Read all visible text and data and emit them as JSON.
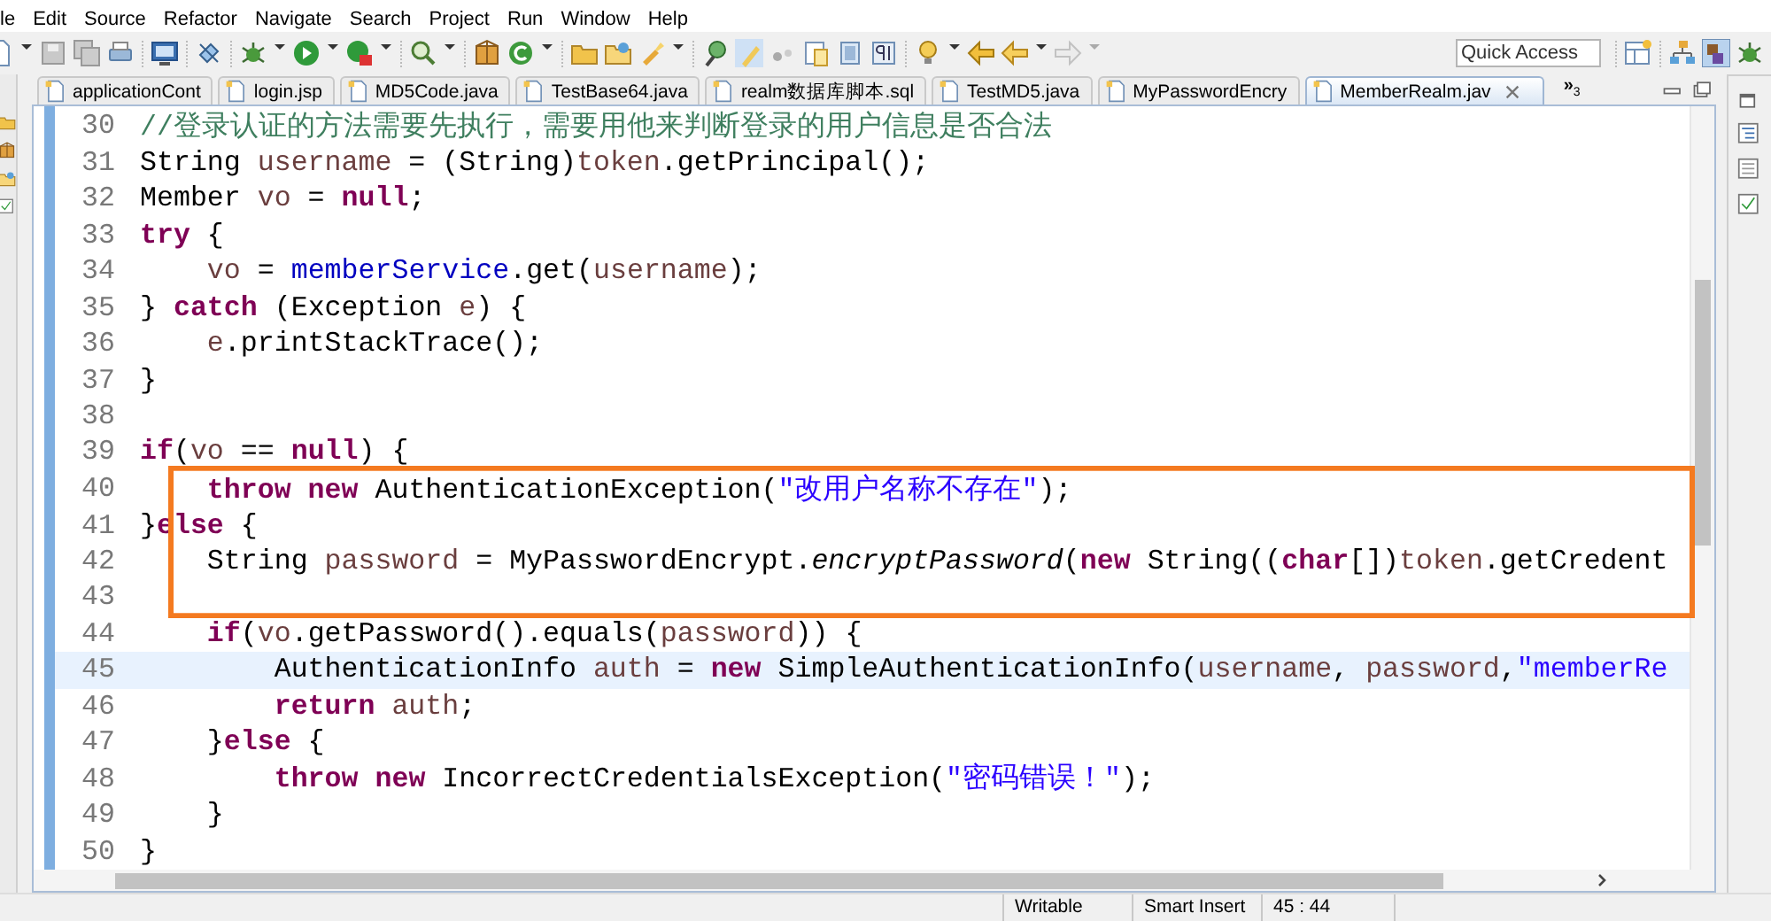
{
  "menu": [
    {
      "label": "le"
    },
    {
      "label": "Edit"
    },
    {
      "label": "Source"
    },
    {
      "label": "Refactor"
    },
    {
      "label": "Navigate"
    },
    {
      "label": "Search"
    },
    {
      "label": "Project"
    },
    {
      "label": "Run"
    },
    {
      "label": "Window"
    },
    {
      "label": "Help"
    }
  ],
  "quick_access": {
    "placeholder": "Quick Access"
  },
  "tabs": [
    {
      "label": "applicationCont",
      "selected": false
    },
    {
      "label": "login.jsp",
      "selected": false
    },
    {
      "label": "MD5Code.java",
      "selected": false
    },
    {
      "label": "TestBase64.java",
      "selected": false
    },
    {
      "label": "realm数据库脚本.sql",
      "selected": false
    },
    {
      "label": "TestMD5.java",
      "selected": false
    },
    {
      "label": "MyPasswordEncry",
      "selected": false
    },
    {
      "label": "MemberRealm.jav",
      "selected": true
    }
  ],
  "tab_overflow": {
    "glyph": "»",
    "count": "3"
  },
  "editor": {
    "lines": [
      {
        "number": "30",
        "current": false,
        "tokens": [
          {
            "kind": "comment",
            "text": "//登录认证的方法需要先执行，需要用他来判断登录的用户信息是否合法"
          }
        ]
      },
      {
        "number": "31",
        "current": false,
        "tokens": [
          {
            "kind": "plain",
            "text": "String "
          },
          {
            "kind": "local",
            "text": "username"
          },
          {
            "kind": "plain",
            "text": " = (String)"
          },
          {
            "kind": "local",
            "text": "token"
          },
          {
            "kind": "plain",
            "text": ".getPrincipal();"
          }
        ]
      },
      {
        "number": "32",
        "current": false,
        "tokens": [
          {
            "kind": "plain",
            "text": "Member "
          },
          {
            "kind": "local",
            "text": "vo"
          },
          {
            "kind": "plain",
            "text": " = "
          },
          {
            "kind": "keyword",
            "text": "null"
          },
          {
            "kind": "plain",
            "text": ";"
          }
        ]
      },
      {
        "number": "33",
        "current": false,
        "tokens": [
          {
            "kind": "keyword",
            "text": "try"
          },
          {
            "kind": "plain",
            "text": " {"
          }
        ]
      },
      {
        "number": "34",
        "current": false,
        "tokens": [
          {
            "kind": "local",
            "text": "    vo"
          },
          {
            "kind": "plain",
            "text": " = "
          },
          {
            "kind": "field",
            "text": "memberService"
          },
          {
            "kind": "plain",
            "text": ".get("
          },
          {
            "kind": "local",
            "text": "username"
          },
          {
            "kind": "plain",
            "text": ");"
          }
        ]
      },
      {
        "number": "35",
        "current": false,
        "tokens": [
          {
            "kind": "plain",
            "text": "} "
          },
          {
            "kind": "keyword",
            "text": "catch"
          },
          {
            "kind": "plain",
            "text": " (Exception "
          },
          {
            "kind": "local",
            "text": "e"
          },
          {
            "kind": "plain",
            "text": ") {"
          }
        ]
      },
      {
        "number": "36",
        "current": false,
        "tokens": [
          {
            "kind": "local",
            "text": "    e"
          },
          {
            "kind": "plain",
            "text": ".printStackTrace();"
          }
        ]
      },
      {
        "number": "37",
        "current": false,
        "tokens": [
          {
            "kind": "plain",
            "text": "}"
          }
        ]
      },
      {
        "number": "38",
        "current": false
      },
      {
        "number": "39",
        "current": false,
        "tokens": [
          {
            "kind": "keyword",
            "text": "if"
          },
          {
            "kind": "plain",
            "text": "("
          },
          {
            "kind": "local",
            "text": "vo"
          },
          {
            "kind": "plain",
            "text": " == "
          },
          {
            "kind": "keyword",
            "text": "null"
          },
          {
            "kind": "plain",
            "text": ") {"
          }
        ]
      },
      {
        "number": "40",
        "current": false,
        "tokens": [
          {
            "kind": "keyword",
            "text": "    throw"
          },
          {
            "kind": "keyword",
            "text": " new"
          },
          {
            "kind": "plain",
            "text": " AuthenticationException("
          },
          {
            "kind": "string",
            "text": "\"改用户名称不存在\""
          },
          {
            "kind": "plain",
            "text": ");"
          }
        ]
      },
      {
        "number": "41",
        "current": false,
        "tokens": [
          {
            "kind": "plain",
            "text": "}"
          },
          {
            "kind": "keyword",
            "text": "else"
          },
          {
            "kind": "plain",
            "text": " {"
          }
        ]
      },
      {
        "number": "42",
        "current": false,
        "tokens": [
          {
            "kind": "plain",
            "text": "    String "
          },
          {
            "kind": "local",
            "text": "password"
          },
          {
            "kind": "plain",
            "text": " = MyPasswordEncrypt."
          },
          {
            "kind": "static",
            "text": "encryptPassword"
          },
          {
            "kind": "plain",
            "text": "("
          },
          {
            "kind": "keyword",
            "text": "new"
          },
          {
            "kind": "plain",
            "text": " String(("
          },
          {
            "kind": "keyword",
            "text": "char"
          },
          {
            "kind": "plain",
            "text": "[])"
          },
          {
            "kind": "local",
            "text": "token"
          },
          {
            "kind": "plain",
            "text": ".getCredent"
          }
        ]
      },
      {
        "number": "43",
        "current": false
      },
      {
        "number": "44",
        "current": false,
        "tokens": [
          {
            "kind": "keyword",
            "text": "    if"
          },
          {
            "kind": "plain",
            "text": "("
          },
          {
            "kind": "local",
            "text": "vo"
          },
          {
            "kind": "plain",
            "text": ".getPassword().equals("
          },
          {
            "kind": "local",
            "text": "password"
          },
          {
            "kind": "plain",
            "text": ")) {"
          }
        ]
      },
      {
        "number": "45",
        "current": true,
        "tokens": [
          {
            "kind": "plain",
            "text": "        AuthenticationInfo "
          },
          {
            "kind": "local",
            "text": "auth"
          },
          {
            "kind": "plain",
            "text": " = "
          },
          {
            "kind": "keyword",
            "text": "new"
          },
          {
            "kind": "plain",
            "text": " SimpleAuthenticationInfo("
          },
          {
            "kind": "local",
            "text": "username"
          },
          {
            "kind": "plain",
            "text": ", "
          },
          {
            "kind": "local",
            "text": "password"
          },
          {
            "kind": "plain",
            "text": ","
          },
          {
            "kind": "string",
            "text": "\"memberRe"
          }
        ]
      },
      {
        "number": "46",
        "current": false,
        "tokens": [
          {
            "kind": "keyword",
            "text": "        return"
          },
          {
            "kind": "local",
            "text": " auth"
          },
          {
            "kind": "plain",
            "text": ";"
          }
        ]
      },
      {
        "number": "47",
        "current": false,
        "tokens": [
          {
            "kind": "plain",
            "text": "    }"
          },
          {
            "kind": "keyword",
            "text": "else"
          },
          {
            "kind": "plain",
            "text": " {"
          }
        ]
      },
      {
        "number": "48",
        "current": false,
        "tokens": [
          {
            "kind": "keyword",
            "text": "        throw"
          },
          {
            "kind": "keyword",
            "text": " new"
          },
          {
            "kind": "plain",
            "text": " IncorrectCredentialsException("
          },
          {
            "kind": "string",
            "text": "\"密码错误！\""
          },
          {
            "kind": "plain",
            "text": ");"
          }
        ]
      },
      {
        "number": "49",
        "current": false,
        "tokens": [
          {
            "kind": "plain",
            "text": "    }"
          }
        ]
      },
      {
        "number": "50",
        "current": false,
        "tokens": [
          {
            "kind": "plain",
            "text": "}"
          }
        ]
      }
    ]
  },
  "status_bar": {
    "mode": "Writable",
    "insert": "Smart Insert",
    "position": "45 : 44"
  }
}
